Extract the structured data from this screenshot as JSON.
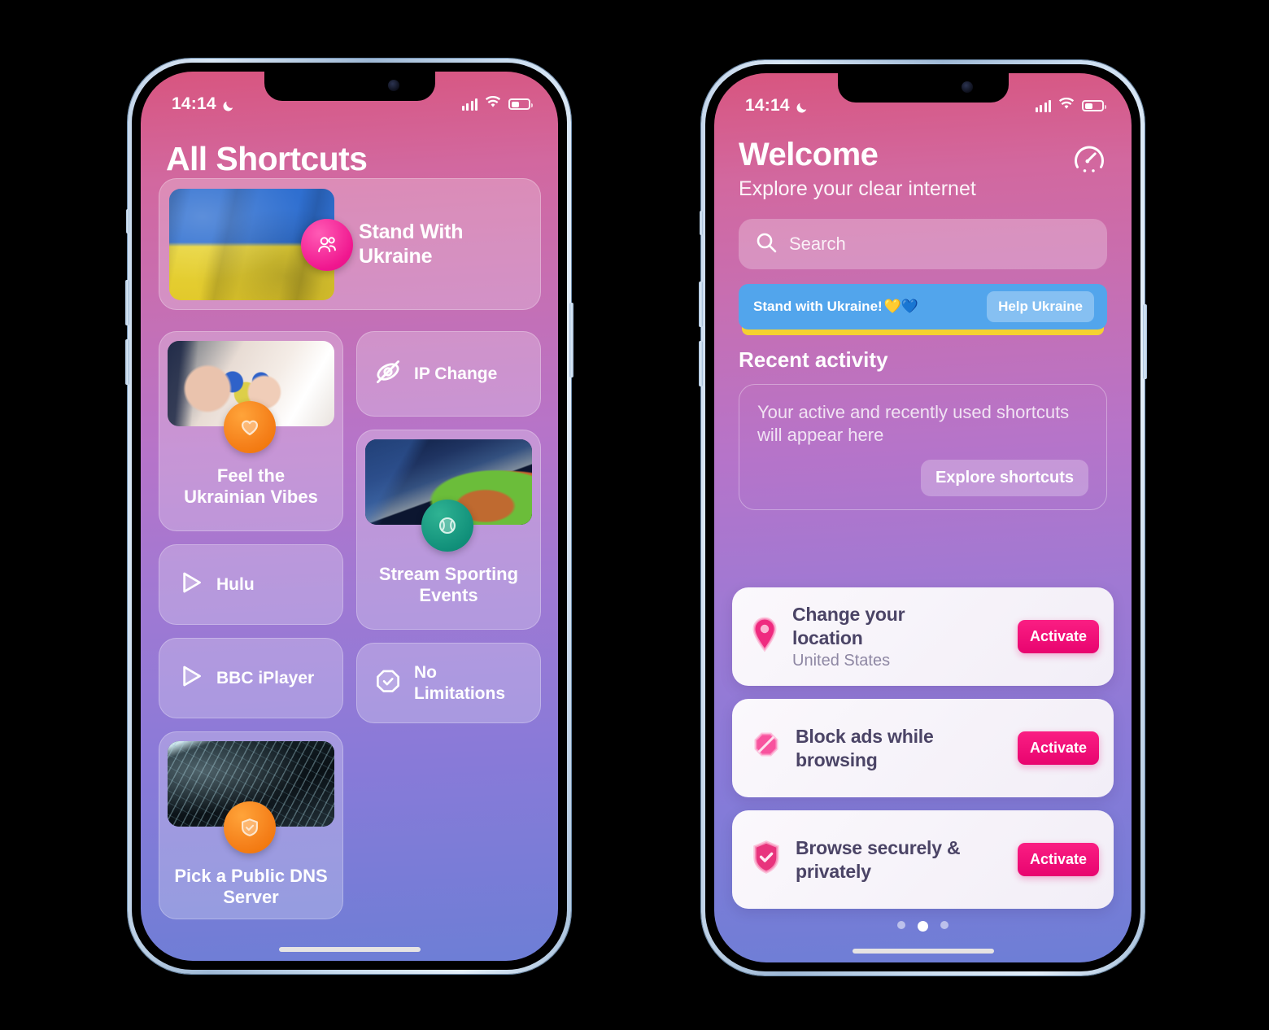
{
  "status_bar": {
    "time": "14:14",
    "moon_icon": "crescent-moon-icon",
    "signal_icon": "cellular-signal-icon",
    "wifi_icon": "wifi-icon",
    "battery_icon": "battery-icon"
  },
  "colors": {
    "accent_pink": "#fa1e83",
    "banner_blue": "#52a5ec",
    "banner_yellow": "#f5d130",
    "badge_orange": "#f5801a",
    "badge_green": "#11907a",
    "badge_pink": "#f0178f",
    "promo_card_bg": "#fbf8fc",
    "promo_title": "#4b4466"
  },
  "left_phone": {
    "title": "All Shortcuts",
    "featured": {
      "label": "Stand With Ukraine",
      "icon": "people-icon",
      "thumb": "ukraine-flag-photo",
      "badge_color": "badge-pink"
    },
    "cards": [
      {
        "label": "Feel the\nUkrainian Vibes",
        "title_line1": "Feel the",
        "title_line2": "Ukrainian Vibes",
        "icon": "heart-icon",
        "thumb": "hands-holding-hearts-photo",
        "badge_color": "badge-orange",
        "type": "tall"
      },
      {
        "label": "IP Change",
        "icon": "eye-off-icon",
        "type": "row"
      },
      {
        "label": "Hulu",
        "icon": "play-icon",
        "type": "row"
      },
      {
        "title_line1": "Stream Sporting",
        "title_line2": "Events",
        "label": "Stream Sporting Events",
        "icon": "tennis-ball-icon",
        "thumb": "stadium-photo",
        "badge_color": "badge-green",
        "type": "tall"
      },
      {
        "label": "BBC iPlayer",
        "icon": "play-icon",
        "type": "row"
      },
      {
        "title_line1": "No",
        "title_line2": "Limitations",
        "label": "No Limitations",
        "icon": "check-octagon-icon",
        "type": "row"
      },
      {
        "title_line1": "Pick a Public DNS",
        "title_line2": "Server",
        "label": "Pick a Public DNS Server",
        "icon": "shield-check-icon",
        "thumb": "circuit-board-photo",
        "badge_color": "badge-orange",
        "type": "tall"
      }
    ]
  },
  "right_phone": {
    "title": "Welcome",
    "subtitle": "Explore your clear internet",
    "speed_test_icon": "speedometer-icon",
    "search": {
      "placeholder": "Search",
      "icon": "search-icon"
    },
    "ukraine_banner": {
      "text": "Stand with Ukraine!",
      "emoji": "💛💙",
      "button": "Help Ukraine"
    },
    "recent": {
      "heading": "Recent activity",
      "empty_text": "Your active and recently used shortcuts will appear here",
      "button": "Explore shortcuts"
    },
    "promos": [
      {
        "title_line1": "Change your",
        "title_line2": "location",
        "subtitle": "United States",
        "button": "Activate",
        "icon": "location-pin-icon"
      },
      {
        "title_line1": "Block ads while",
        "title_line2": "browsing",
        "subtitle": "",
        "button": "Activate",
        "icon": "block-icon"
      },
      {
        "title_line1": "Browse securely &",
        "title_line2": "privately",
        "subtitle": "",
        "button": "Activate",
        "icon": "shield-check-icon"
      }
    ],
    "page_dots": {
      "count": 3,
      "active_index": 1
    }
  }
}
